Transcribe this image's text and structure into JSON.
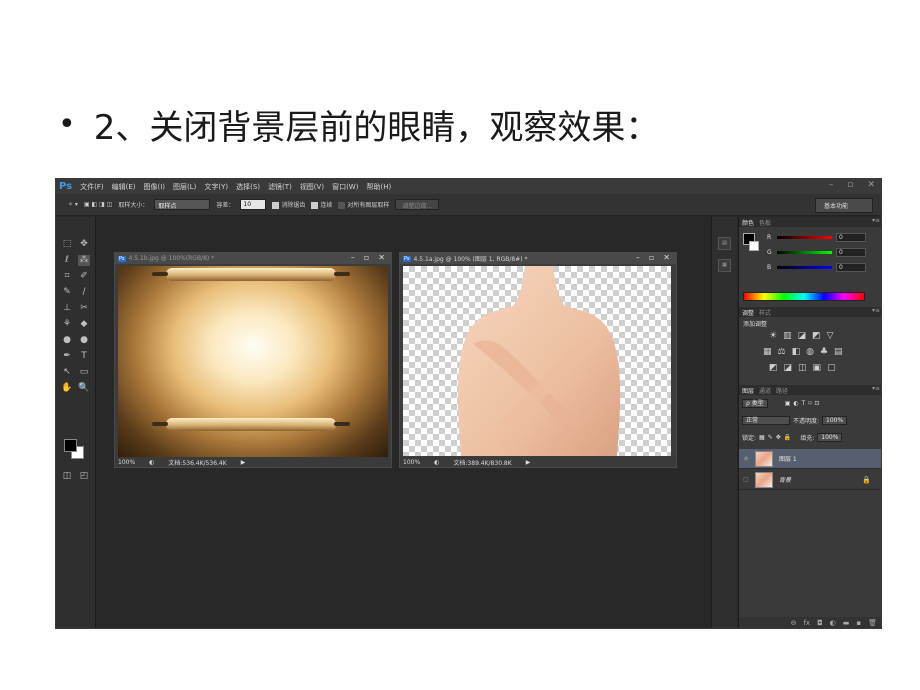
{
  "slide": {
    "bullet": "•",
    "title": "2、关闭背景层前的眼睛，观察效果："
  },
  "app": {
    "logo": "Ps",
    "menu": [
      "文件(F)",
      "编辑(E)",
      "图像(I)",
      "图层(L)",
      "文字(Y)",
      "选择(S)",
      "滤镜(T)",
      "视图(V)",
      "窗口(W)",
      "帮助(H)"
    ],
    "window_controls": [
      "–",
      "▫",
      "✕"
    ]
  },
  "options": {
    "sample_size_label": "取样大小：",
    "sample_size_value": "取样点",
    "tolerance_label": "容差：",
    "tolerance_value": "10",
    "antialias_label": "消除锯齿",
    "contiguous_label": "连续",
    "all_layers_label": "对所有图层取样",
    "refine_edge_label": "调整边缘...",
    "workspace_label": "基本功能"
  },
  "doc1": {
    "title": "4.5.1b.jpg @ 100%(RGB/8) *",
    "zoom": "100%",
    "doc_size": "文档:536.4K/536.4K",
    "controls": [
      "–",
      "▫",
      "✕"
    ]
  },
  "doc2": {
    "title": "4.5.1a.jpg @ 100% (图层 1, RGB/8#) *",
    "zoom": "100%",
    "doc_size": "文档:389.4K/830.8K",
    "controls": [
      "–",
      "▫",
      "✕"
    ]
  },
  "color_panel": {
    "tabs": [
      "颜色",
      "色板"
    ],
    "channels": [
      {
        "label": "R",
        "value": "0",
        "color": "#d11f1f"
      },
      {
        "label": "G",
        "value": "0",
        "color": "#27b327"
      },
      {
        "label": "B",
        "value": "0",
        "color": "#2a3fd8"
      }
    ]
  },
  "adjustments_panel": {
    "tabs": [
      "调整",
      "样式"
    ],
    "heading": "添加调整",
    "icon_rows": [
      [
        "☀",
        "▥",
        "◪",
        "◩",
        "▽"
      ],
      [
        "▦",
        "⚖",
        "◧",
        "◍",
        "♣",
        "▤"
      ],
      [
        "◩",
        "◪",
        "◫",
        "▣",
        "▢"
      ]
    ]
  },
  "layers_panel": {
    "tabs": [
      "图层",
      "通道",
      "路径"
    ],
    "filter_label": "ρ 类型",
    "filter_icons": [
      "▣",
      "◐",
      "T",
      "⌑",
      "⊡"
    ],
    "blend_mode": "正常",
    "opacity_label": "不透明度:",
    "opacity_value": "100%",
    "lock_label": "锁定:",
    "lock_icons": [
      "▦",
      "✎",
      "✥",
      "🔒"
    ],
    "fill_label": "填充:",
    "fill_value": "100%",
    "layers": [
      {
        "name": "图层 1",
        "visible": true,
        "selected": true
      },
      {
        "name": "背景",
        "visible": false,
        "selected": false,
        "locked": true
      }
    ],
    "footer_icons": [
      "⊖",
      "fx",
      "◘",
      "◐",
      "▬",
      "▪",
      "🗑"
    ]
  },
  "tools": [
    "⬚",
    "✥",
    "ℓ",
    "⁂",
    "⌗",
    "✐",
    "✎",
    "∕",
    "⊥",
    "✂",
    "⚘",
    "◆",
    "●",
    "●",
    "✒",
    "T",
    "↖",
    "▭",
    "✋",
    "🔍"
  ]
}
